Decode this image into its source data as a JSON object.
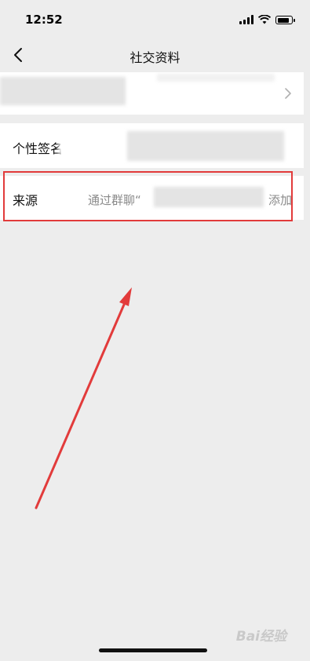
{
  "status_bar": {
    "time": "12:52"
  },
  "nav": {
    "title": "社交资料"
  },
  "rows": {
    "signature_label": "个性签名",
    "source_label": "来源",
    "source_value": "通过群聊“",
    "source_suffix": "添加"
  },
  "watermark": "Bai经验",
  "colors": {
    "highlight": "#e23b3b",
    "background": "#ededed"
  }
}
